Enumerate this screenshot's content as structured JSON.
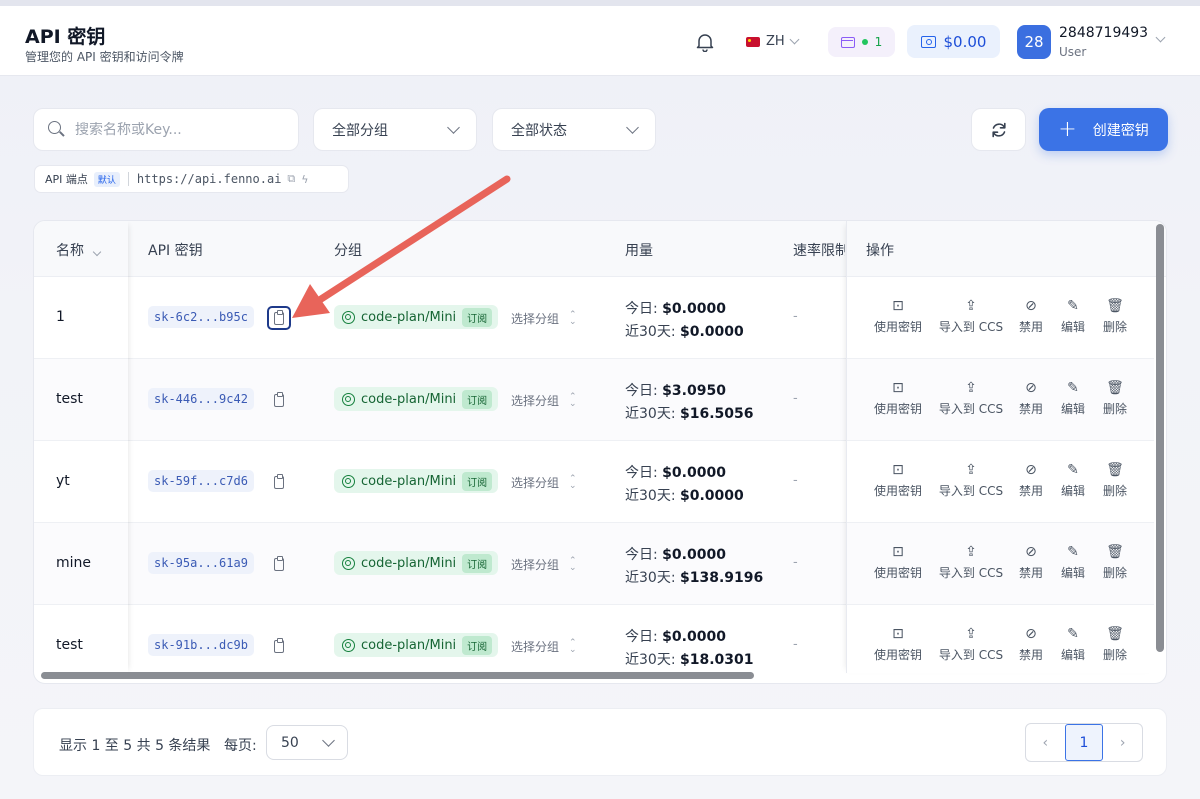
{
  "header": {
    "title": "API 密钥",
    "subtitle": "管理您的 API 密钥和访问令牌",
    "language": "ZH",
    "plan_count": "1",
    "balance": "$0.00",
    "avatar_text": "28",
    "user_name": "2848719493",
    "user_role": "User"
  },
  "toolbar": {
    "search_placeholder": "搜索名称或Key...",
    "group_filter": "全部分组",
    "status_filter": "全部状态",
    "create_label": "创建密钥"
  },
  "endpoint": {
    "label": "API 端点",
    "default_badge": "默认",
    "url": "https://api.fenno.ai"
  },
  "table": {
    "columns": [
      "名称",
      "API 密钥",
      "分组",
      "用量",
      "速率限制",
      "操作"
    ],
    "today_label": "今日:",
    "month_label": "近30天:",
    "select_group_label": "选择分组",
    "subscription_badge": "订阅",
    "action_labels": [
      "使用密钥",
      "导入到 CCS",
      "禁用",
      "编辑",
      "删除"
    ],
    "rows": [
      {
        "name": "1",
        "key": "sk-6c2...b95c",
        "group": "code-plan/Mini",
        "today": "$0.0000",
        "month": "$0.0000",
        "rate": "-"
      },
      {
        "name": "test",
        "key": "sk-446...9c42",
        "group": "code-plan/Mini",
        "today": "$3.0950",
        "month": "$16.5056",
        "rate": "-"
      },
      {
        "name": "yt",
        "key": "sk-59f...c7d6",
        "group": "code-plan/Mini",
        "today": "$0.0000",
        "month": "$0.0000",
        "rate": "-"
      },
      {
        "name": "mine",
        "key": "sk-95a...61a9",
        "group": "code-plan/Mini",
        "today": "$0.0000",
        "month": "$138.9196",
        "rate": "-"
      },
      {
        "name": "test",
        "key": "sk-91b...dc9b",
        "group": "code-plan/Mini",
        "today": "$0.0000",
        "month": "$18.0301",
        "rate": "-"
      }
    ]
  },
  "footer": {
    "result_text": "显示 1 至 5 共 5 条结果",
    "per_page_label": "每页:",
    "per_page_value": "50",
    "current_page": "1"
  },
  "colors": {
    "accent": "#3b73e6",
    "annotation_arrow": "#e8645a",
    "group_pill_bg": "#e4f6ec"
  }
}
